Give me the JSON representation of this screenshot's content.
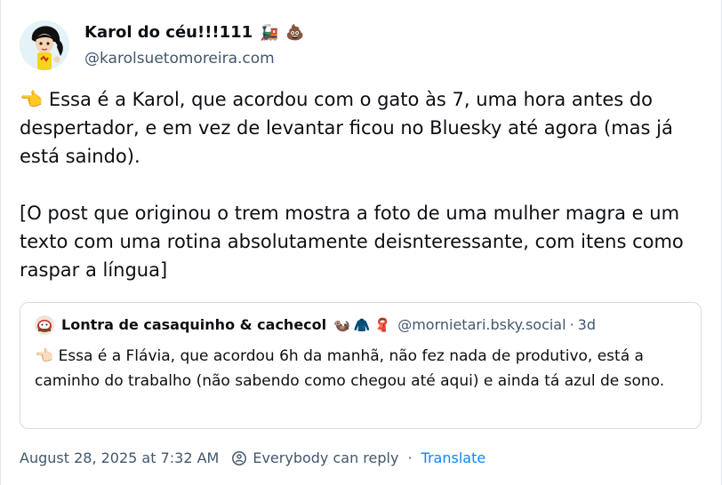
{
  "author": {
    "display_name": "Karol do céu!!!111",
    "name_emojis": [
      "🚂",
      "💩"
    ],
    "handle": "@karolsuetomoreira.com",
    "avatar_icon": "cartoon-girl-avatar"
  },
  "post": {
    "paragraphs": [
      "👈 Essa é a Karol, que acordou com o gato às 7, uma hora antes do despertador, e em vez de levantar ficou no Bluesky até agora (mas já está saindo).",
      "[O post que originou o trem mostra a foto de uma mulher magra e um texto com uma rotina absolutamente deisnteressante, com itens como raspar a língua]"
    ]
  },
  "quote": {
    "display_name": "Lontra de casaquinho & cachecol",
    "name_emojis": [
      "🦦",
      "🧥",
      "🧣"
    ],
    "handle": "@mornietari.bsky.social",
    "separator": "·",
    "time": "3d",
    "text": "👈🏻 Essa é a Flávia, que acordou 6h da manhã, não fez nada de produtivo, está a caminho do trabalho (não sabendo como chegou até aqui) e ainda tá azul de sono."
  },
  "meta": {
    "timestamp": "August 28, 2025 at 7:32 AM",
    "reply_setting": "Everybody can reply",
    "separator": "·",
    "translate_label": "Translate"
  },
  "colors": {
    "text": "#0b0f14",
    "muted": "#42576c",
    "link": "#1083fe",
    "border": "#d4dbe2"
  }
}
